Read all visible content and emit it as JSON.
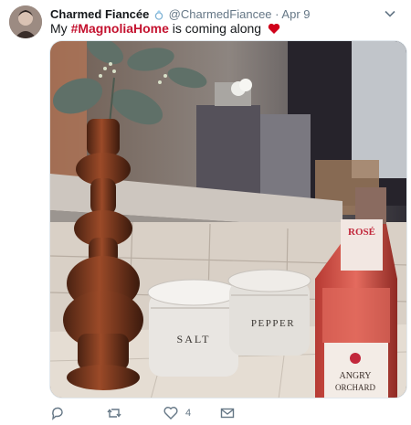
{
  "tweet": {
    "author_name": "Charmed Fiancée",
    "handle": "@CharmedFiancee",
    "separator": "·",
    "timestamp": "Apr 9",
    "text_before": "My ",
    "hashtag": "#MagnoliaHome",
    "text_after": " is coming along"
  },
  "media": {
    "jar_left_label": "SALT",
    "jar_right_label": "PEPPER",
    "bottle_label_top": "ROSÉ",
    "bottle_label_bottom_1": "ANGRY",
    "bottle_label_bottom_2": "ORCHARD"
  },
  "actions": {
    "like_count": "4"
  },
  "colors": {
    "hashtag": "#c4122f",
    "heart": "#e0245e",
    "muted": "#657786"
  }
}
